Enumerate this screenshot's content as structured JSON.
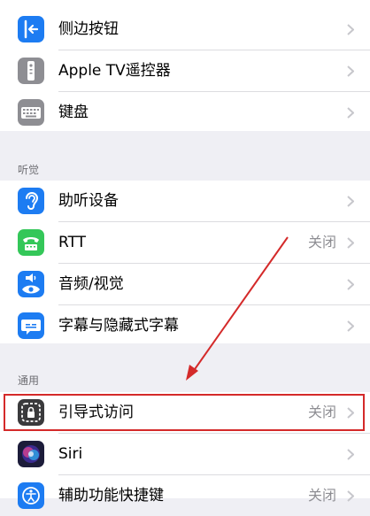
{
  "top_group": {
    "items": [
      {
        "label": "侧边按钮",
        "icon": "side-button-icon",
        "icon_color": "#1d7cf2"
      },
      {
        "label": "Apple TV遥控器",
        "icon": "remote-icon",
        "icon_color": "#8e8e93"
      },
      {
        "label": "键盘",
        "icon": "keyboard-icon",
        "icon_color": "#8e8e93"
      }
    ]
  },
  "hearing": {
    "header": "听觉",
    "items": [
      {
        "label": "助听设备",
        "icon": "ear-icon",
        "icon_color": "#1d7cf2"
      },
      {
        "label": "RTT",
        "value": "关闭",
        "icon": "tty-icon",
        "icon_color": "#34c759"
      },
      {
        "label": "音频/视觉",
        "icon": "audio-visual-icon",
        "icon_color": "#1d7cf2"
      },
      {
        "label": "字幕与隐藏式字幕",
        "icon": "subtitles-icon",
        "icon_color": "#1d7cf2"
      }
    ]
  },
  "general": {
    "header": "通用",
    "items": [
      {
        "label": "引导式访问",
        "value": "关闭",
        "icon": "guided-access-icon",
        "icon_color": "#3a3a3c"
      },
      {
        "label": "Siri",
        "icon": "siri-icon",
        "icon_color": "#2b2b6e"
      },
      {
        "label": "辅助功能快捷键",
        "value": "关闭",
        "icon": "accessibility-icon",
        "icon_color": "#1d7cf2"
      }
    ]
  },
  "colors": {
    "background": "#efeff4",
    "highlight": "#d42a2a",
    "chevron": "#c7c7cc"
  }
}
